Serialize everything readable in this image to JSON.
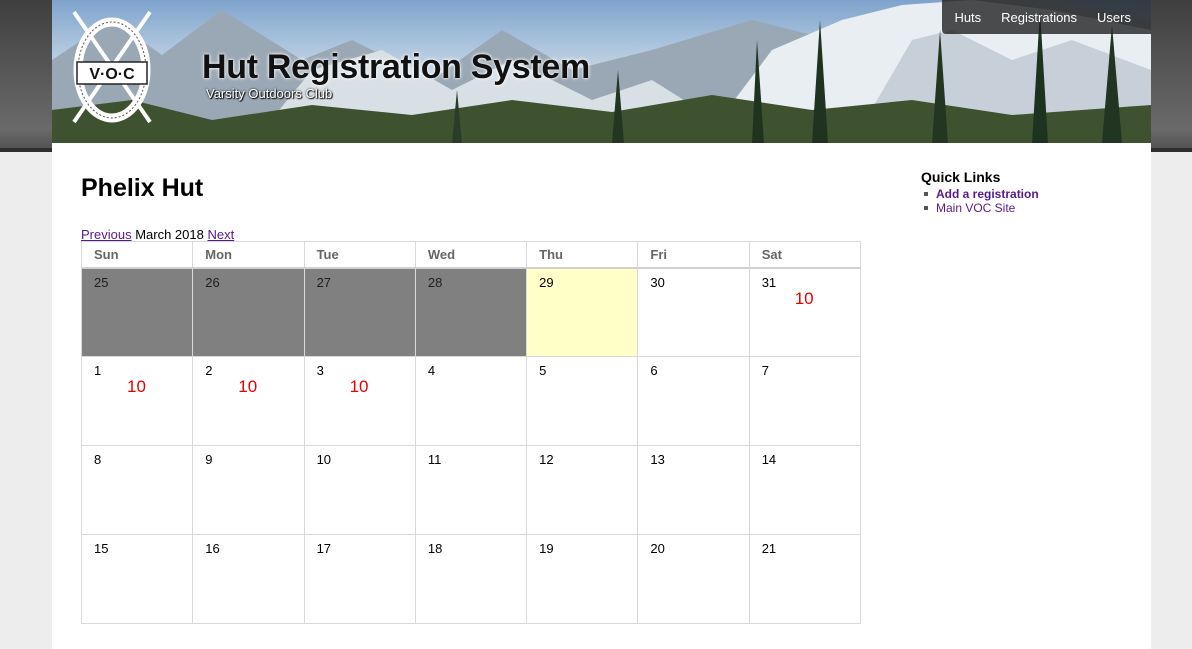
{
  "header": {
    "logo_text": "V·O·C",
    "site_title": "Hut Registration System",
    "site_subtitle": "Varsity Outdoors Club"
  },
  "nav": {
    "huts": "Huts",
    "registrations": "Registrations",
    "users": "Users"
  },
  "page": {
    "title": "Phelix Hut"
  },
  "calendar": {
    "prev_label": "Previous",
    "month_label": "March 2018",
    "next_label": "Next",
    "weekdays": [
      "Sun",
      "Mon",
      "Tue",
      "Wed",
      "Thu",
      "Fri",
      "Sat"
    ],
    "weeks": [
      [
        {
          "day": "25",
          "count": "",
          "state": "past"
        },
        {
          "day": "26",
          "count": "",
          "state": "past"
        },
        {
          "day": "27",
          "count": "",
          "state": "past"
        },
        {
          "day": "28",
          "count": "",
          "state": "past"
        },
        {
          "day": "29",
          "count": "",
          "state": "today"
        },
        {
          "day": "30",
          "count": "",
          "state": ""
        },
        {
          "day": "31",
          "count": "10",
          "state": ""
        }
      ],
      [
        {
          "day": "1",
          "count": "10",
          "state": ""
        },
        {
          "day": "2",
          "count": "10",
          "state": ""
        },
        {
          "day": "3",
          "count": "10",
          "state": ""
        },
        {
          "day": "4",
          "count": "",
          "state": ""
        },
        {
          "day": "5",
          "count": "",
          "state": ""
        },
        {
          "day": "6",
          "count": "",
          "state": ""
        },
        {
          "day": "7",
          "count": "",
          "state": ""
        }
      ],
      [
        {
          "day": "8",
          "count": "",
          "state": ""
        },
        {
          "day": "9",
          "count": "",
          "state": ""
        },
        {
          "day": "10",
          "count": "",
          "state": ""
        },
        {
          "day": "11",
          "count": "",
          "state": ""
        },
        {
          "day": "12",
          "count": "",
          "state": ""
        },
        {
          "day": "13",
          "count": "",
          "state": ""
        },
        {
          "day": "14",
          "count": "",
          "state": ""
        }
      ],
      [
        {
          "day": "15",
          "count": "",
          "state": ""
        },
        {
          "day": "16",
          "count": "",
          "state": ""
        },
        {
          "day": "17",
          "count": "",
          "state": ""
        },
        {
          "day": "18",
          "count": "",
          "state": ""
        },
        {
          "day": "19",
          "count": "",
          "state": ""
        },
        {
          "day": "20",
          "count": "",
          "state": ""
        },
        {
          "day": "21",
          "count": "",
          "state": ""
        }
      ]
    ]
  },
  "quick_links": {
    "title": "Quick Links",
    "items": [
      {
        "label": "Add a registration"
      },
      {
        "label": "Main VOC Site"
      }
    ]
  },
  "colors": {
    "past_day": "#808080",
    "today": "#ffffc8",
    "count_text": "#e60000",
    "link": "#551a8b"
  }
}
